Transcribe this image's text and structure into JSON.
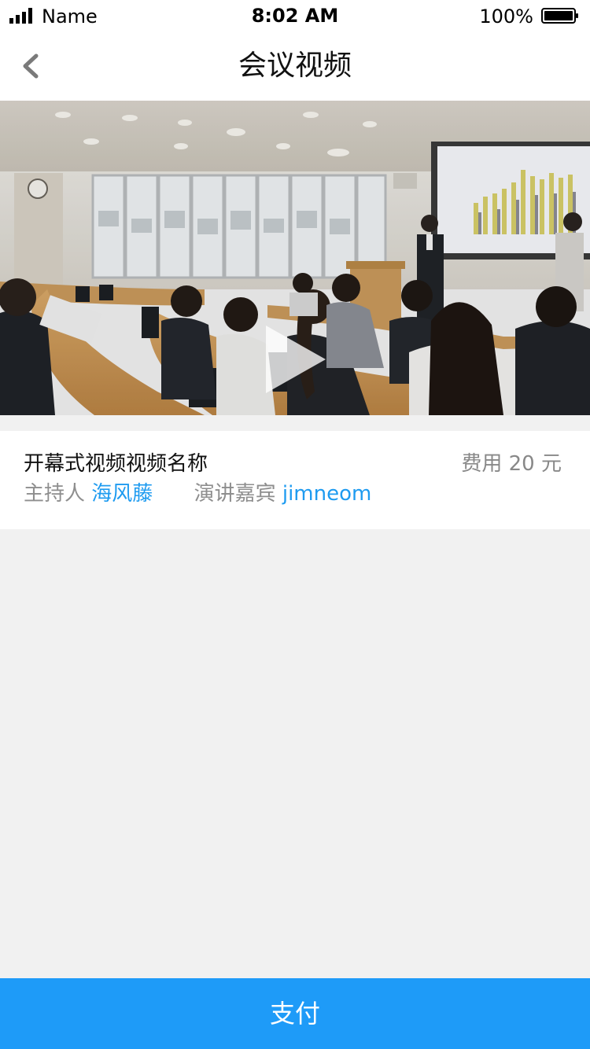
{
  "status_bar": {
    "carrier": "Name",
    "time": "8:02 AM",
    "battery_percent": "100%"
  },
  "nav": {
    "title": "会议视频",
    "back_icon": "chevron-left-icon"
  },
  "video": {
    "thumbnail": "conference-room-presentation",
    "play_icon": "play-icon"
  },
  "info": {
    "video_name": "开幕式视频视频名称",
    "fee_label": "费用",
    "fee_amount": "20",
    "fee_unit": "元",
    "host_label": "主持人",
    "host_name": "海风藤",
    "speaker_label": "演讲嘉宾",
    "speaker_name": "jimneom"
  },
  "actions": {
    "pay_label": "支付"
  },
  "colors": {
    "accent": "#1e9bf8",
    "link": "#1e9bf0",
    "page_bg": "#f1f1f1"
  }
}
